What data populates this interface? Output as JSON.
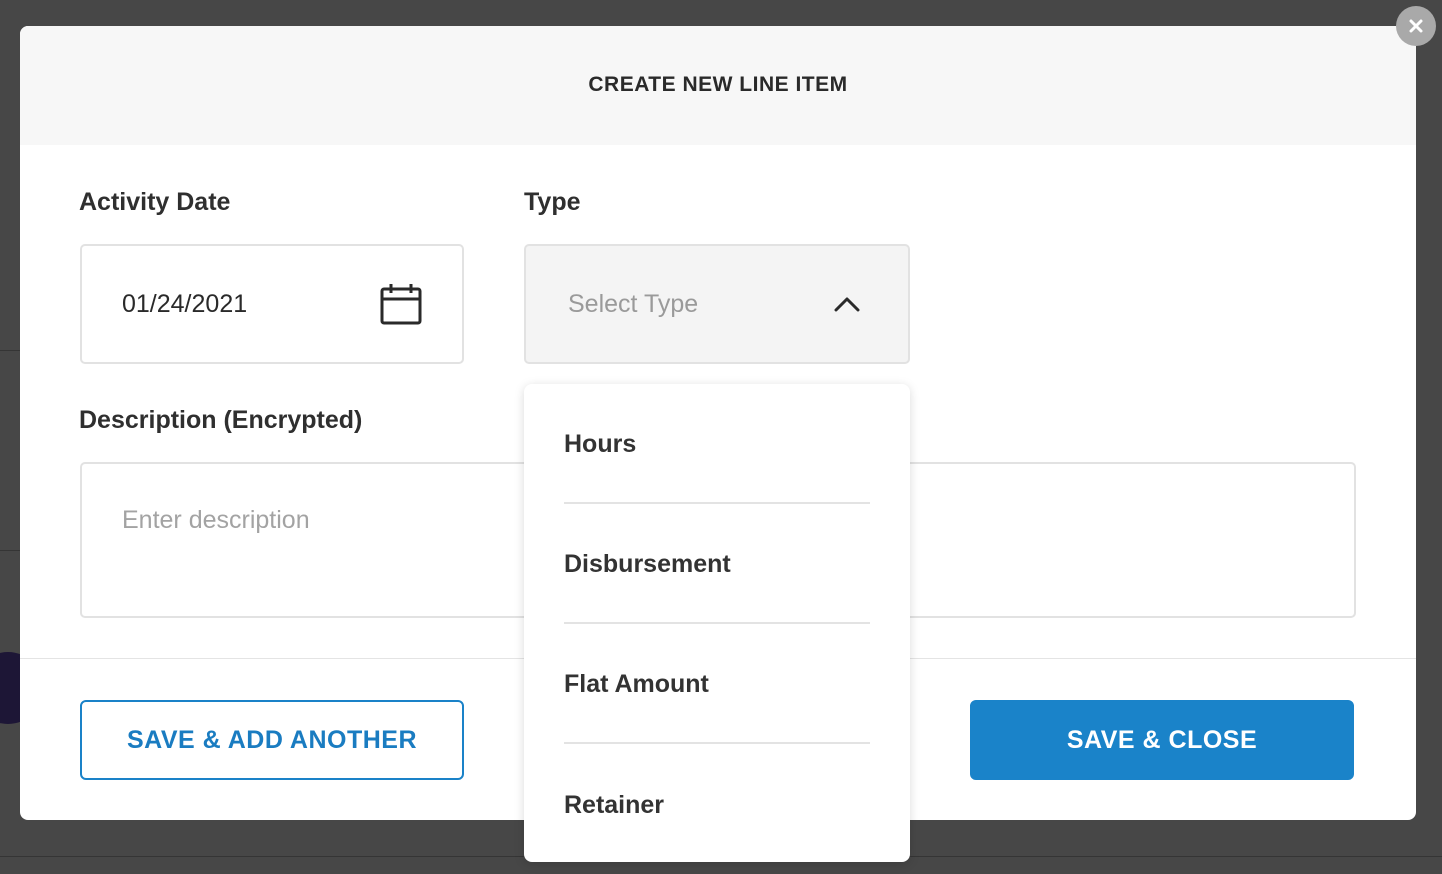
{
  "modal": {
    "title": "CREATE NEW LINE ITEM",
    "activity_date": {
      "label": "Activity Date",
      "value": "01/24/2021",
      "icon": "calendar-icon"
    },
    "type": {
      "label": "Type",
      "placeholder": "Select Type",
      "icon": "chevron-up-icon",
      "options": [
        "Hours",
        "Disbursement",
        "Flat Amount",
        "Retainer"
      ]
    },
    "description": {
      "label": "Description (Encrypted)",
      "placeholder": "Enter description"
    },
    "buttons": {
      "save_add_another": "SAVE & ADD ANOTHER",
      "save_close": "SAVE & CLOSE"
    }
  },
  "colors": {
    "accent": "#1a83c9",
    "header_bg": "#f7f7f7",
    "backdrop": "#4a4a4a"
  }
}
